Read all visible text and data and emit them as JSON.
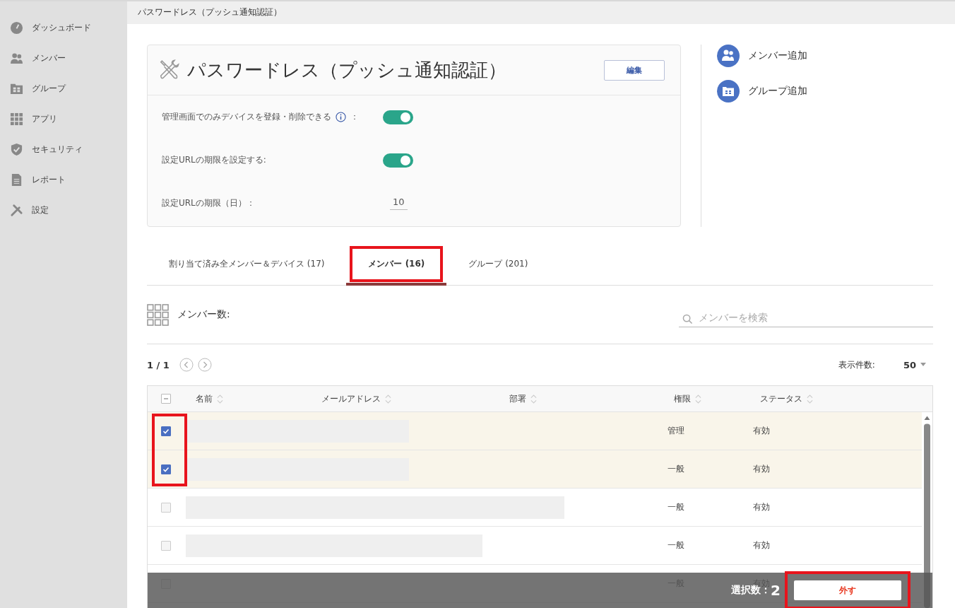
{
  "sidebar": {
    "items": [
      {
        "label": "ダッシュボード"
      },
      {
        "label": "メンバー"
      },
      {
        "label": "グループ"
      },
      {
        "label": "アプリ"
      },
      {
        "label": "セキュリティ"
      },
      {
        "label": "レポート"
      },
      {
        "label": "設定"
      }
    ]
  },
  "breadcrumb": "パスワードレス（プッシュ通知認証）",
  "policy": {
    "title": "パスワードレス（プッシュ通知認証）",
    "edit_button": "編集",
    "settings": [
      {
        "kind": "toggle",
        "label": "管理画面でのみデバイスを登録・削除できる",
        "info": true,
        "suffix": "：",
        "on": true
      },
      {
        "kind": "toggle",
        "label": "設定URLの期限を設定する:",
        "on": true
      },
      {
        "kind": "number",
        "label": "設定URLの期限（日）：",
        "value": "10"
      }
    ]
  },
  "actions": [
    {
      "label": "メンバー追加"
    },
    {
      "label": "グループ追加"
    }
  ],
  "tabs": [
    {
      "label": "割り当て済み全メンバー＆デバイス (17)",
      "selected": false,
      "highlighted": false
    },
    {
      "label": "メンバー (16)",
      "selected": true,
      "highlighted": true
    },
    {
      "label": "グループ (201)",
      "selected": false,
      "highlighted": false
    }
  ],
  "member_count_label": "メンバー数:",
  "search": {
    "placeholder": "メンバーを検索"
  },
  "pagination": {
    "page": "1 / 1"
  },
  "page_size": {
    "label": "表示件数:",
    "value": "50"
  },
  "table": {
    "columns": [
      "名前",
      "メールアドレス",
      "部署",
      "権限",
      "ステータス"
    ],
    "select_all_partial": true,
    "checkbox_column_highlighted": true,
    "rows": [
      {
        "checked": true,
        "role": "管理",
        "status": "有効"
      },
      {
        "checked": true,
        "role": "一般",
        "status": "有効"
      },
      {
        "checked": false,
        "role": "一般",
        "status": "有効"
      },
      {
        "checked": false,
        "role": "一般",
        "status": "有効"
      },
      {
        "checked": false,
        "role": "一般",
        "status": "有効"
      }
    ]
  },
  "bulk_bar": {
    "label": "選択数：",
    "count": "2",
    "button": "外す",
    "button_highlighted": true
  }
}
